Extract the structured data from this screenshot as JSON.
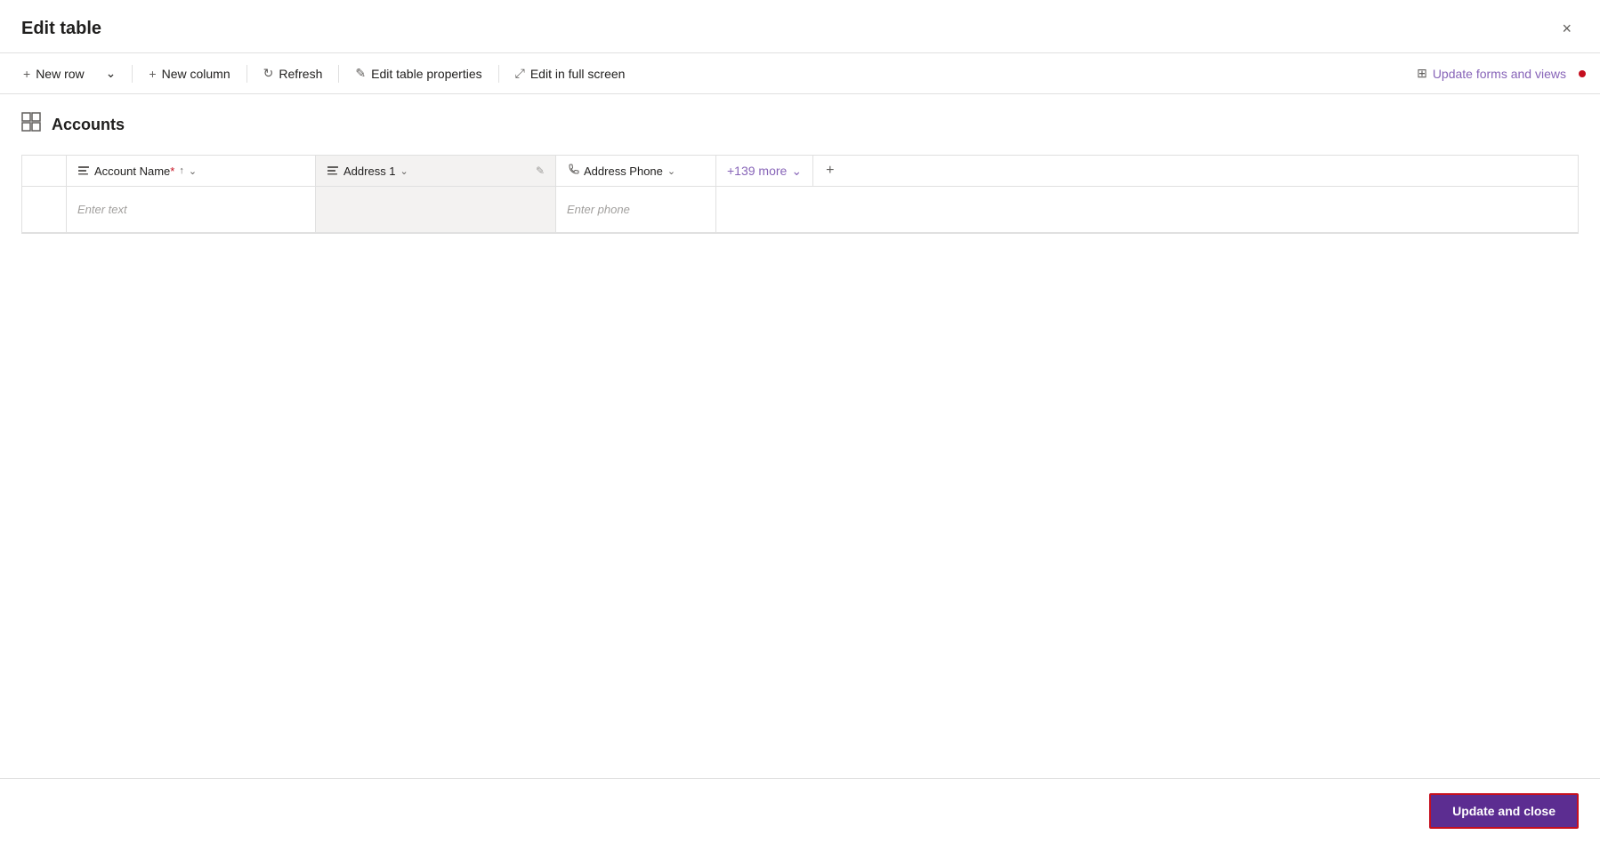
{
  "dialog": {
    "title": "Edit table",
    "close_label": "×"
  },
  "toolbar": {
    "new_row_label": "New row",
    "new_column_label": "New column",
    "refresh_label": "Refresh",
    "edit_table_properties_label": "Edit table properties",
    "edit_in_full_screen_label": "Edit in full screen",
    "update_forms_label": "Update forms and views"
  },
  "table": {
    "name": "Accounts",
    "grid_icon": "⊞"
  },
  "columns": [
    {
      "id": "account_name",
      "icon": "Aa",
      "label": "Account Name",
      "required": true,
      "sorted": true,
      "has_dropdown": true,
      "placeholder": "Enter text"
    },
    {
      "id": "address1",
      "icon": "Aa",
      "label": "Address 1",
      "has_dropdown": true,
      "has_edit": true,
      "placeholder": ""
    },
    {
      "id": "address_phone",
      "icon": "☎",
      "label": "Address Phone",
      "has_dropdown": true,
      "placeholder": "Enter phone"
    }
  ],
  "more_columns": {
    "label": "+139 more",
    "has_dropdown": true
  },
  "footer": {
    "update_close_label": "Update and close"
  }
}
